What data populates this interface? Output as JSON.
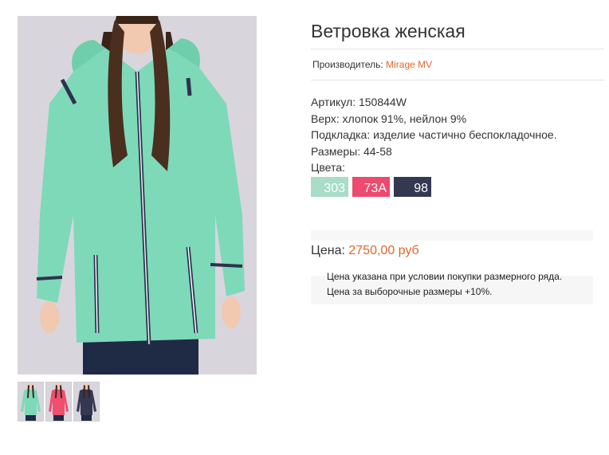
{
  "product": {
    "title": "Ветровка женская",
    "manufacturer_label": "Производитель:",
    "manufacturer_name": "Mirage MV",
    "specs": [
      "Артикул: 150844W",
      "Верх: хлопок 91%, нейлон 9%",
      "Подкладка: изделие частично беспокладочное.",
      "Размеры: 44-58",
      "Цвета:"
    ],
    "colors": [
      {
        "code": "303",
        "hex": "#a8ddc8"
      },
      {
        "code": "73A",
        "hex": "#ec4a6e"
      },
      {
        "code": "98",
        "hex": "#353851"
      }
    ],
    "price_label": "Цена:",
    "price_value": "2750,00 руб",
    "notes": [
      "Цена указана при условии покупки размерного ряда.",
      "Цена за выборочные размеры +10%."
    ]
  },
  "gallery": {
    "main_color": "#7ed9b8",
    "thumbs": [
      {
        "color": "#7ed9b8"
      },
      {
        "color": "#ef4e6e"
      },
      {
        "color": "#353851"
      }
    ]
  },
  "accent_color": "#e2662c"
}
